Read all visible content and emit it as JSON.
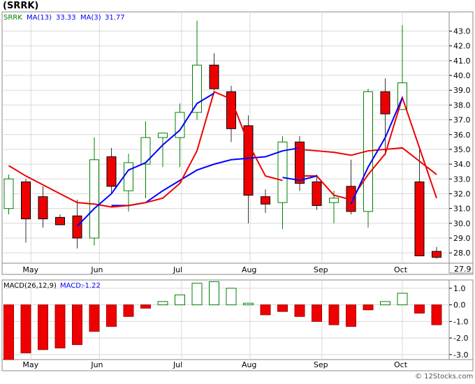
{
  "chart_data": [
    {
      "type": "candlestick",
      "title": "(SRRK)",
      "legend": [
        {
          "label": "SRRK",
          "color": "#008000"
        },
        {
          "label": "MA(13)",
          "value": "33.33",
          "color": "#0000ff"
        },
        {
          "label": "MA(3)",
          "value": "31.77",
          "color": "#0000ff"
        }
      ],
      "x_month_labels": [
        "May",
        "Jun",
        "Jul",
        "Aug",
        "Sep",
        "Oct"
      ],
      "y_ticks": [
        "28.0",
        "29.0",
        "30.0",
        "31.0",
        "32.0",
        "33.0",
        "34.0",
        "35.0",
        "36.0",
        "37.0",
        "38.0",
        "39.0",
        "40.0",
        "41.0",
        "42.0",
        "43.0"
      ],
      "ylim": [
        27.3,
        44.3
      ],
      "last_price_label": "27.9",
      "candles": [
        {
          "o": 31.0,
          "h": 33.3,
          "l": 30.6,
          "c": 33.0
        },
        {
          "o": 32.8,
          "h": 33.0,
          "l": 28.7,
          "c": 30.3
        },
        {
          "o": 31.8,
          "h": 32.5,
          "l": 29.7,
          "c": 30.3
        },
        {
          "o": 30.4,
          "h": 30.6,
          "l": 29.9,
          "c": 29.9
        },
        {
          "o": 30.5,
          "h": 31.6,
          "l": 28.3,
          "c": 29.0
        },
        {
          "o": 29.0,
          "h": 35.8,
          "l": 28.5,
          "c": 34.3
        },
        {
          "o": 34.5,
          "h": 35.1,
          "l": 32.0,
          "c": 32.5
        },
        {
          "o": 32.2,
          "h": 34.7,
          "l": 30.8,
          "c": 34.1
        },
        {
          "o": 34.0,
          "h": 36.9,
          "l": 31.7,
          "c": 35.8
        },
        {
          "o": 35.8,
          "h": 36.1,
          "l": 33.8,
          "c": 36.1
        },
        {
          "o": 35.8,
          "h": 38.1,
          "l": 33.8,
          "c": 37.5
        },
        {
          "o": 37.5,
          "h": 43.7,
          "l": 37.0,
          "c": 40.7
        },
        {
          "o": 40.7,
          "h": 41.5,
          "l": 39.0,
          "c": 39.1
        },
        {
          "o": 38.9,
          "h": 39.3,
          "l": 35.5,
          "c": 36.4
        },
        {
          "o": 36.6,
          "h": 37.3,
          "l": 30.0,
          "c": 31.9
        },
        {
          "o": 31.8,
          "h": 32.3,
          "l": 30.7,
          "c": 31.3
        },
        {
          "o": 31.4,
          "h": 35.9,
          "l": 29.6,
          "c": 35.5
        },
        {
          "o": 35.5,
          "h": 35.9,
          "l": 32.2,
          "c": 32.7
        },
        {
          "o": 32.8,
          "h": 33.3,
          "l": 30.9,
          "c": 31.2
        },
        {
          "o": 31.4,
          "h": 32.2,
          "l": 30.0,
          "c": 31.7
        },
        {
          "o": 32.5,
          "h": 34.3,
          "l": 30.6,
          "c": 30.8
        },
        {
          "o": 30.8,
          "h": 39.1,
          "l": 29.7,
          "c": 38.9
        },
        {
          "o": 38.9,
          "h": 39.8,
          "l": 34.6,
          "c": 37.4
        },
        {
          "o": 37.7,
          "h": 43.4,
          "l": 37.8,
          "c": 39.5
        },
        {
          "o": 32.8,
          "h": 35.0,
          "l": 27.8,
          "c": 27.8
        },
        {
          "o": 28.1,
          "h": 28.4,
          "l": 27.6,
          "c": 27.7
        }
      ],
      "ma_red": [
        33.9,
        33.2,
        32.6,
        32.0,
        31.4,
        31.3,
        31.1,
        31.2,
        31.4,
        31.7,
        32.7,
        34.9,
        38.9,
        38.4,
        35.4,
        33.2,
        32.9,
        33.2,
        33.2,
        31.9,
        31.6,
        33.3,
        34.7,
        38.5,
        35.1,
        31.7
      ],
      "ma_blue": [
        null,
        null,
        null,
        null,
        29.8,
        31.0,
        32.0,
        33.6,
        34.1,
        35.3,
        36.3,
        38.1,
        38.8,
        null,
        null,
        null,
        null,
        null,
        null,
        null,
        31.3,
        33.8,
        35.8,
        38.5,
        null,
        null
      ],
      "ma_blue2": [
        null,
        null,
        null,
        null,
        null,
        null,
        31.2,
        31.2,
        31.4,
        32.2,
        32.9,
        33.6,
        34.0,
        34.3,
        34.4,
        34.5,
        34.9,
        35.1,
        null,
        null,
        null,
        null,
        null,
        null,
        null,
        null
      ],
      "ma_blue2_tail": {
        "from_index": 16,
        "values": [
          33.1,
          32.9,
          33.2
        ]
      },
      "ma_red_tail": {
        "from_index": 17,
        "values": [
          35.0,
          34.9,
          34.8,
          34.6,
          34.9,
          35.0,
          35.1,
          34.2,
          33.3
        ]
      }
    },
    {
      "type": "bar",
      "title": "MACD(26,12,9)",
      "legend": [
        {
          "label": "MACD(26,12,9)",
          "color": "#000000"
        },
        {
          "label": "MACD:",
          "value": "-1.22",
          "color": "#0000ff"
        }
      ],
      "y_ticks": [
        "1.0",
        "0.0",
        "-1.0",
        "-2.0",
        "-3.0"
      ],
      "ylim": [
        -3.3,
        1.5
      ],
      "values": [
        -3.3,
        -2.9,
        -2.7,
        -2.6,
        -2.4,
        -1.6,
        -1.3,
        -0.7,
        -0.2,
        0.2,
        0.6,
        1.3,
        1.4,
        1.0,
        0.1,
        -0.6,
        -0.4,
        -0.7,
        -1.0,
        -1.2,
        -1.3,
        -0.3,
        0.2,
        0.7,
        -0.5,
        -1.2
      ]
    }
  ],
  "watermark": "© 12Stocks.com"
}
